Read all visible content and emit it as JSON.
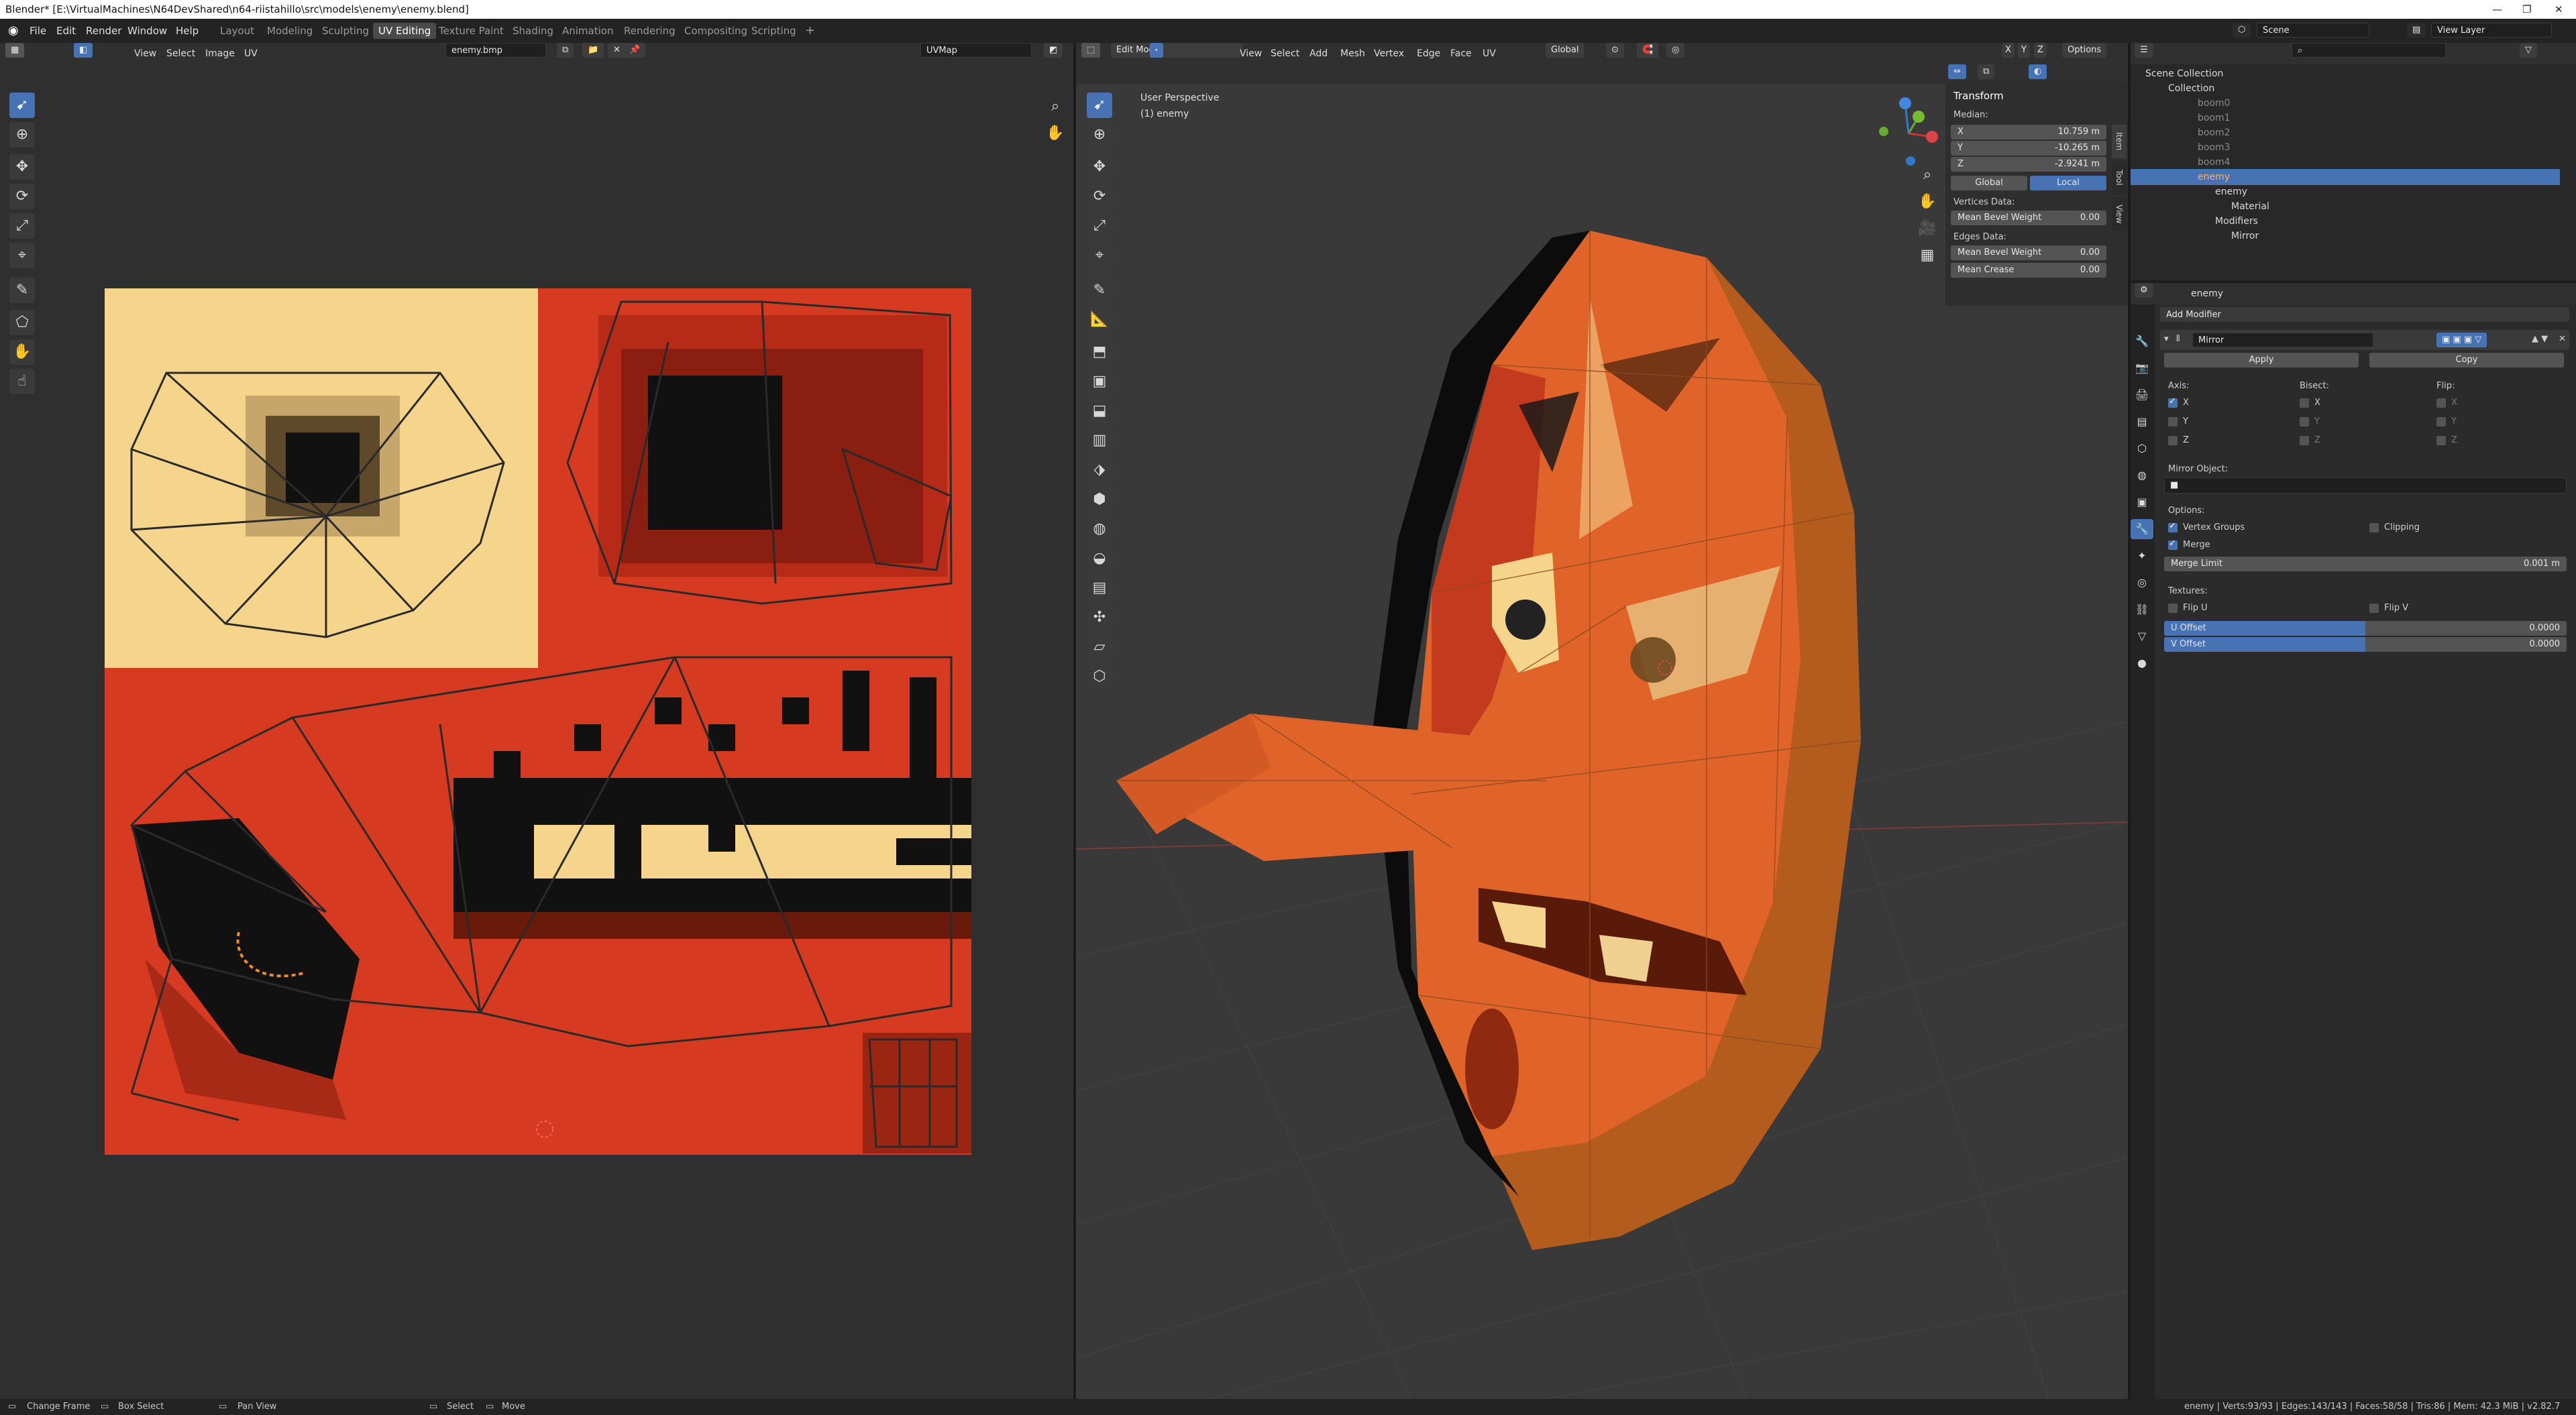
{
  "title_bar": {
    "title": "Blender* [E:\\VirtualMachines\\N64DevShared\\n64-riistahillo\\src\\models\\enemy\\enemy.blend]"
  },
  "menu": [
    "File",
    "Edit",
    "Render",
    "Window",
    "Help"
  ],
  "workspaces": [
    "Layout",
    "Modeling",
    "Sculpting",
    "UV Editing",
    "Texture Paint",
    "Shading",
    "Animation",
    "Rendering",
    "Compositing",
    "Scripting"
  ],
  "active_workspace": "UV Editing",
  "scene": {
    "label": "Scene",
    "view_layer": "View Layer"
  },
  "uv_editor": {
    "menus": [
      "View",
      "Select",
      "Image",
      "UV"
    ],
    "image_name": "enemy.bmp",
    "uv_map": "UVMap"
  },
  "viewport": {
    "mode": "Edit Mode",
    "menus": [
      "View",
      "Select",
      "Add",
      "Mesh",
      "Vertex",
      "Edge",
      "Face",
      "UV"
    ],
    "orientation": "Global",
    "options_label": "Options",
    "overlay_title": "User Perspective",
    "overlay_object": "(1) enemy",
    "xyz": [
      "X",
      "Y",
      "Z"
    ],
    "side_tabs": [
      "Item",
      "Tool",
      "View"
    ]
  },
  "transform_panel": {
    "title": "Transform",
    "median_label": "Median:",
    "x": {
      "label": "X",
      "value": "10.759 m"
    },
    "y": {
      "label": "Y",
      "value": "-10.265 m"
    },
    "z": {
      "label": "Z",
      "value": "-2.9241 m"
    },
    "global": "Global",
    "local": "Local",
    "vertices_data": "Vertices Data:",
    "mean_bevel_weight_v": {
      "label": "Mean Bevel Weight",
      "value": "0.00"
    },
    "edges_data": "Edges Data:",
    "mean_bevel_weight_e": {
      "label": "Mean Bevel Weight",
      "value": "0.00"
    },
    "mean_crease": {
      "label": "Mean Crease",
      "value": "0.00"
    }
  },
  "outliner": {
    "scene_collection": "Scene Collection",
    "collection": "Collection",
    "items": [
      "boom0",
      "boom1",
      "boom2",
      "boom3",
      "boom4"
    ],
    "enemy": "enemy",
    "enemy_mesh": "enemy",
    "material": "Material",
    "modifiers": "Modifiers",
    "mirror": "Mirror"
  },
  "properties": {
    "object_name": "enemy",
    "add_modifier": "Add Modifier",
    "modifier_name": "Mirror",
    "apply": "Apply",
    "copy": "Copy",
    "axis_label": "Axis:",
    "bisect_label": "Bisect:",
    "flip_label": "Flip:",
    "axes": [
      "X",
      "Y",
      "Z"
    ],
    "mirror_object": "Mirror Object:",
    "options": "Options:",
    "vertex_groups": "Vertex Groups",
    "clipping": "Clipping",
    "merge": "Merge",
    "merge_limit": {
      "label": "Merge Limit",
      "value": "0.001 m"
    },
    "textures": "Textures:",
    "flip_u": "Flip U",
    "flip_v": "Flip V",
    "u_offset": {
      "label": "U Offset",
      "value": "0.0000"
    },
    "v_offset": {
      "label": "V Offset",
      "value": "0.0000"
    }
  },
  "status_bar": {
    "change_frame": "Change Frame",
    "box_select": "Box Select",
    "pan_view": "Pan View",
    "select": "Select",
    "move": "Move",
    "stats": "enemy | Verts:93/93 | Edges:143/143 | Faces:58/58 | Tris:86 | Mem: 42.3 MiB | v2.82.7"
  },
  "colors": {
    "accent": "#4772b3",
    "texture_red": "#d63a20",
    "texture_cream": "#f5d58c",
    "mesh_orange": "#e0642a"
  }
}
